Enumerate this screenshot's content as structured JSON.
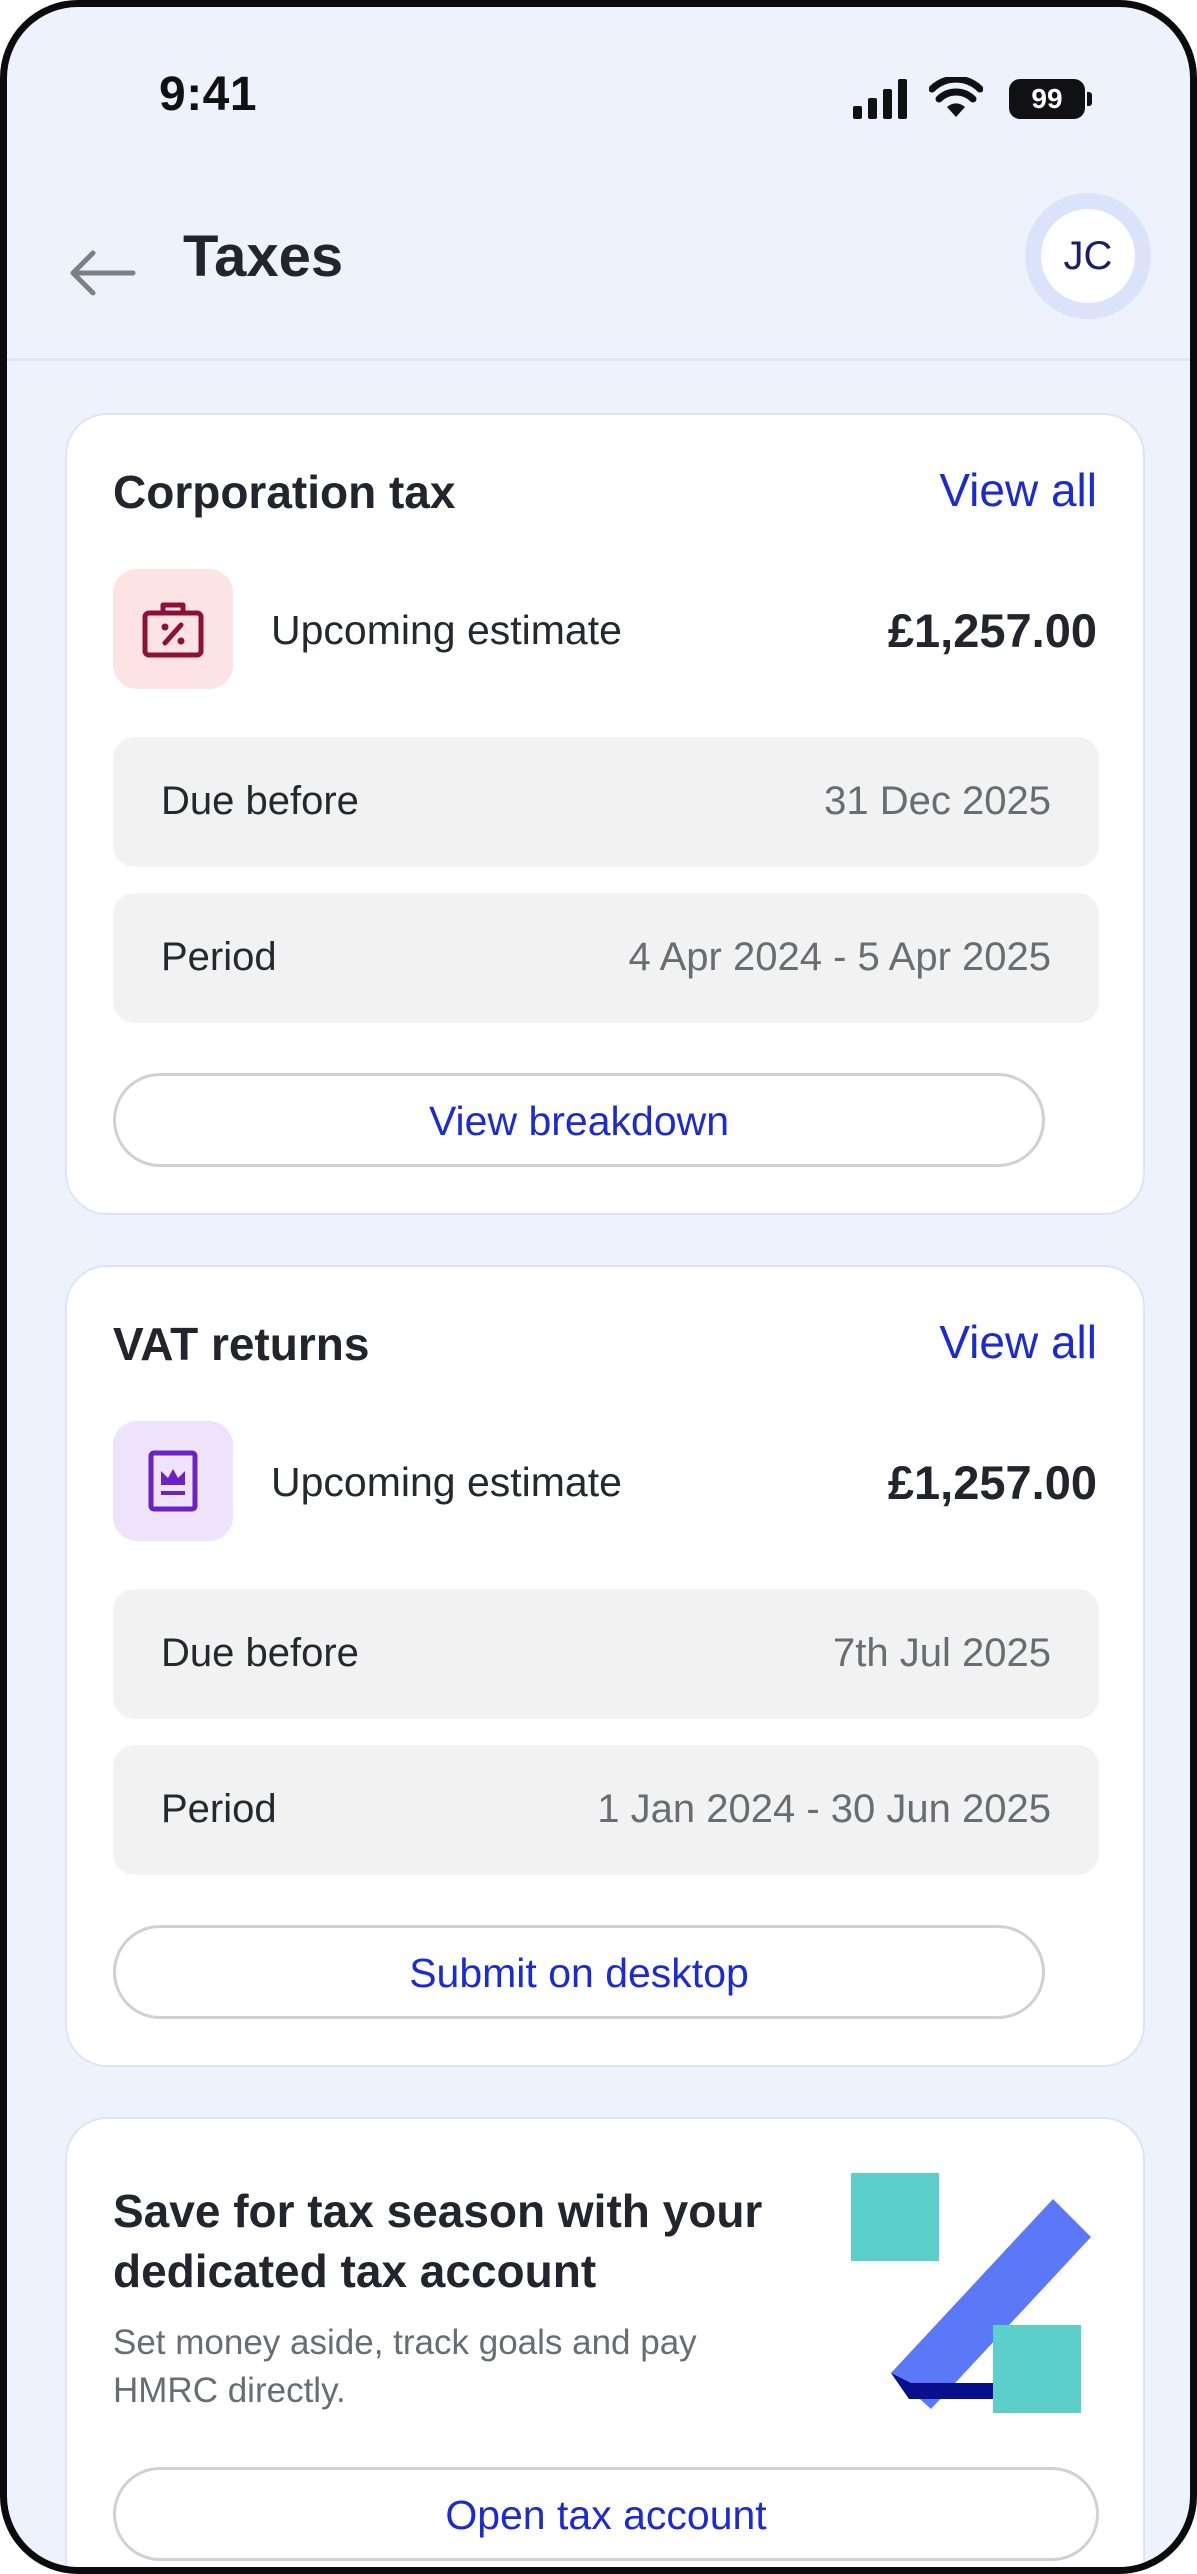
{
  "status_bar": {
    "time": "9:41",
    "battery": "99",
    "icons": [
      "signal-icon",
      "wifi-icon",
      "battery-icon"
    ]
  },
  "header": {
    "title": "Taxes",
    "avatar_initials": "JC",
    "back_icon": "arrow-left-icon"
  },
  "corporation_tax": {
    "title": "Corporation tax",
    "view_all": "View all",
    "icon": "briefcase-percent-icon",
    "estimate_label": "Upcoming estimate",
    "estimate_amount": "£1,257.00",
    "rows": [
      {
        "label": "Due before",
        "value": "31 Dec 2025"
      },
      {
        "label": "Period",
        "value": "4 Apr 2024 - 5 Apr 2025"
      }
    ],
    "button": "View breakdown"
  },
  "vat_returns": {
    "title": "VAT returns",
    "view_all": "View all",
    "icon": "crown-document-icon",
    "estimate_label": "Upcoming estimate",
    "estimate_amount": "£1,257.00",
    "rows": [
      {
        "label": "Due before",
        "value": "7th Jul 2025"
      },
      {
        "label": "Period",
        "value": "1 Jan 2024 - 30 Jun 2025"
      }
    ],
    "button": "Submit on desktop"
  },
  "promo": {
    "title": "Save for tax season with your dedicated tax account",
    "description": "Set money aside, track goals and pay HMRC directly.",
    "button": "Open tax account",
    "illustration": "percent-illustration"
  },
  "colors": {
    "background": "#eef2fd",
    "accent": "#1c2bd1",
    "corp_icon_bg": "#fde3e3",
    "corp_icon_fg": "#8e1039",
    "vat_icon_bg": "#efe2fb",
    "vat_icon_fg": "#6e21c2",
    "illustration_teal": "#5ccfcb",
    "illustration_blue": "#5a78f8",
    "illustration_navy": "#0a0f8c"
  }
}
